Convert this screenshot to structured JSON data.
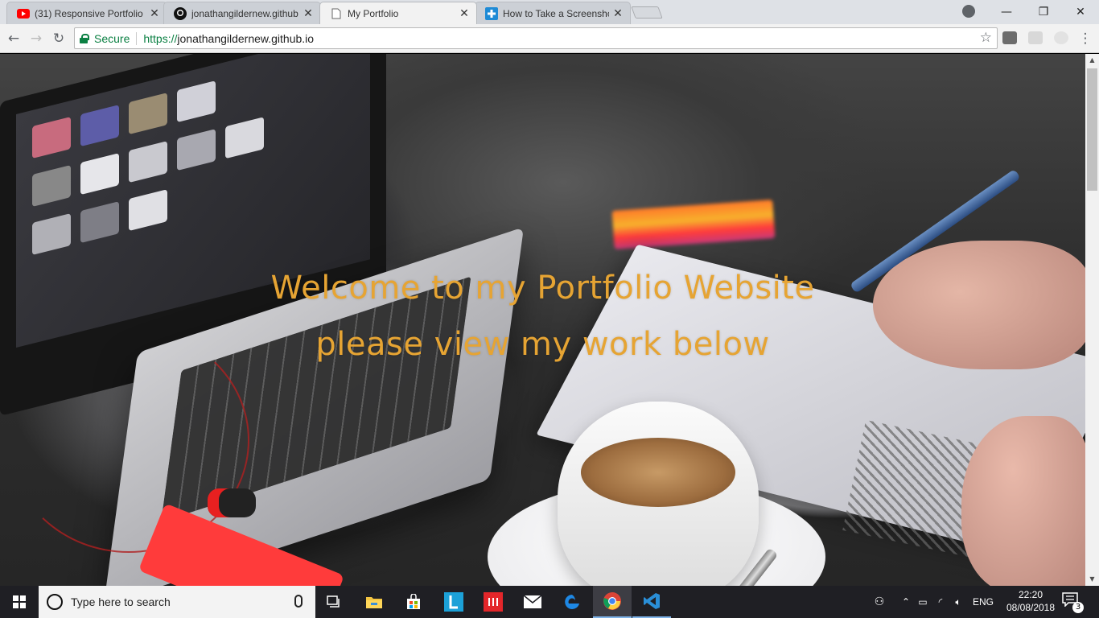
{
  "browser": {
    "tabs": [
      {
        "title": "(31) Responsive Portfolio",
        "favicon": "youtube-icon"
      },
      {
        "title": "jonathangildernew.github",
        "favicon": "github-icon"
      },
      {
        "title": "My Portfolio",
        "favicon": "page-icon",
        "active": true
      },
      {
        "title": "How to Take a Screenshot",
        "favicon": "howto-icon"
      }
    ],
    "secure_label": "Secure",
    "url_scheme": "https://",
    "url_host": "jonathangildernew.github.io"
  },
  "page": {
    "hero_line_1": "Welcome to my Portfolio Website",
    "hero_line_2": "please view my work below",
    "hero_color": "#e6a433"
  },
  "taskbar": {
    "search_placeholder": "Type here to search",
    "language": "ENG",
    "time": "22:20",
    "date": "08/08/2018",
    "notification_count": "3",
    "apps": [
      "task-view-icon",
      "file-explorer-icon",
      "store-icon",
      "lexico-app-icon",
      "red-app-icon",
      "mail-icon",
      "edge-icon",
      "chrome-icon",
      "vscode-icon"
    ]
  }
}
